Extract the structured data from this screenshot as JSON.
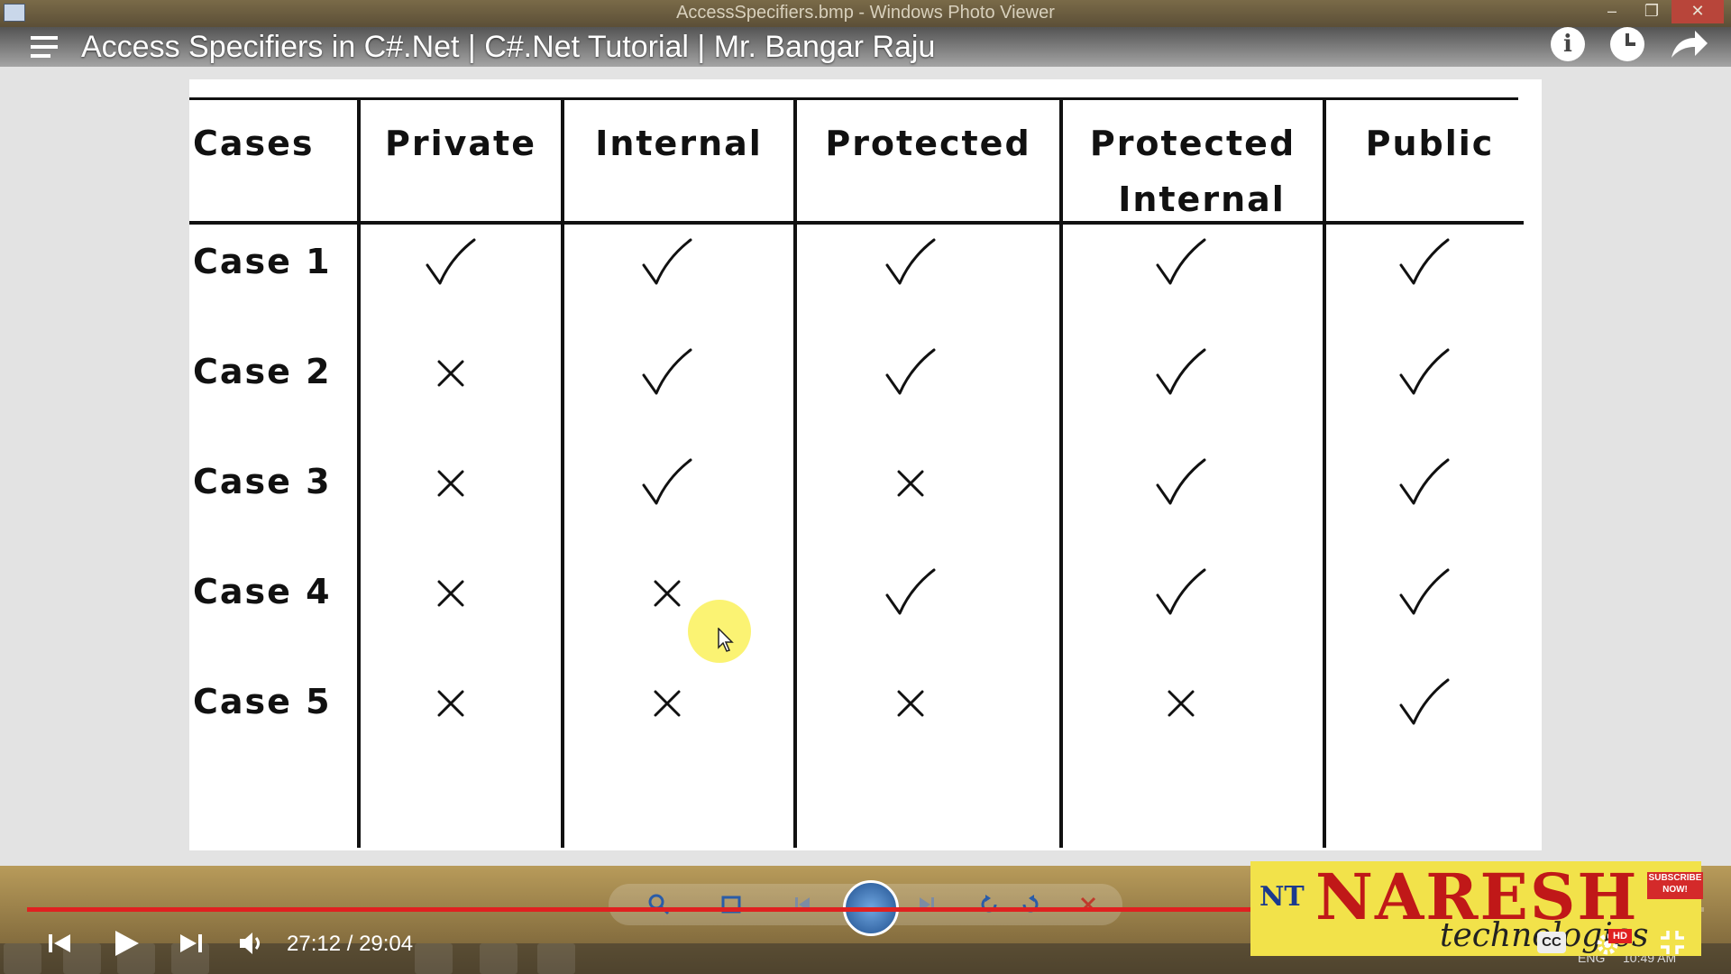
{
  "window": {
    "title": "AccessSpecifiers.bmp - Windows Photo Viewer",
    "min_glyph": "–",
    "max_glyph": "❐",
    "close_glyph": "✕"
  },
  "video": {
    "title": "Access Specifiers in C#.Net | C#.Net Tutorial | Mr. Bangar Raju",
    "time_display": "27:12 / 29:04",
    "progress_fraction": 0.936
  },
  "table": {
    "headers": {
      "cases": "Cases",
      "private": "Private",
      "internal": "Internal",
      "protected": "Protected",
      "protected_internal_1": "Protected",
      "protected_internal_2": "Internal",
      "public": "Public"
    },
    "rows": [
      {
        "case": "Case 1",
        "marks": [
          "check",
          "check",
          "check",
          "check",
          "check"
        ]
      },
      {
        "case": "Case 2",
        "marks": [
          "cross",
          "check",
          "check",
          "check",
          "check"
        ]
      },
      {
        "case": "Case 3",
        "marks": [
          "cross",
          "check",
          "cross",
          "check",
          "check"
        ]
      },
      {
        "case": "Case 4",
        "marks": [
          "cross",
          "cross",
          "check",
          "check",
          "check"
        ]
      },
      {
        "case": "Case 5",
        "marks": [
          "cross",
          "cross",
          "cross",
          "cross",
          "check"
        ]
      }
    ]
  },
  "logo": {
    "brand": "NARESH",
    "sub": "technologies",
    "mark": "NT",
    "subscribe": "SUBSCRIBE NOW!"
  },
  "player": {
    "cc_label": "CC",
    "hd_label": "HD"
  },
  "tray": {
    "lang": "ENG",
    "clock": "10:49 AM"
  },
  "colors": {
    "progress": "#e02020",
    "logo_bg": "#f2e24a",
    "logo_text": "#c01818"
  }
}
